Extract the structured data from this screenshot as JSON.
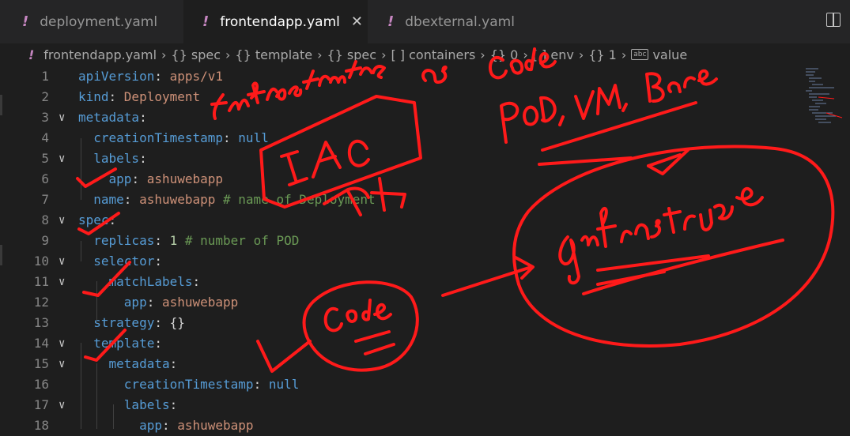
{
  "tabs": [
    {
      "label": "deployment.yaml",
      "active": false
    },
    {
      "label": "frontendapp.yaml",
      "active": true
    },
    {
      "label": "dbexternal.yaml",
      "active": false
    }
  ],
  "breadcrumb": {
    "file": "frontendapp.yaml",
    "items": [
      "{} spec",
      "{} template",
      "{} spec",
      "[ ] containers",
      "{} 0",
      "[ ] env",
      "{} 1",
      "value"
    ]
  },
  "lines": [
    {
      "num": "1",
      "fold": "",
      "key": "apiVersion",
      "sep": ": ",
      "val": "apps/v1",
      "valtype": "v",
      "comment": ""
    },
    {
      "num": "2",
      "fold": "",
      "key": "kind",
      "sep": ": ",
      "val": "Deployment",
      "valtype": "v",
      "comment": ""
    },
    {
      "num": "3",
      "fold": "∨",
      "key": "metadata",
      "sep": ":",
      "val": "",
      "valtype": "v",
      "comment": ""
    },
    {
      "num": "4",
      "fold": "",
      "key": "  creationTimestamp",
      "sep": ": ",
      "val": "null",
      "valtype": "k",
      "comment": ""
    },
    {
      "num": "5",
      "fold": "∨",
      "key": "  labels",
      "sep": ":",
      "val": "",
      "valtype": "v",
      "comment": ""
    },
    {
      "num": "6",
      "fold": "",
      "key": "    app",
      "sep": ": ",
      "val": "ashuwebapp",
      "valtype": "v",
      "comment": ""
    },
    {
      "num": "7",
      "fold": "",
      "key": "  name",
      "sep": ": ",
      "val": "ashuwebapp",
      "valtype": "v",
      "comment": " # name of Deployment"
    },
    {
      "num": "8",
      "fold": "∨",
      "key": "spec",
      "sep": ":",
      "val": "",
      "valtype": "v",
      "comment": ""
    },
    {
      "num": "9",
      "fold": "",
      "key": "  replicas",
      "sep": ": ",
      "val": "1",
      "valtype": "n",
      "comment": " # number of POD"
    },
    {
      "num": "10",
      "fold": "∨",
      "key": "  selector",
      "sep": ":",
      "val": "",
      "valtype": "v",
      "comment": ""
    },
    {
      "num": "11",
      "fold": "∨",
      "key": "    matchLabels",
      "sep": ":",
      "val": "",
      "valtype": "v",
      "comment": ""
    },
    {
      "num": "12",
      "fold": "",
      "key": "      app",
      "sep": ": ",
      "val": "ashuwebapp",
      "valtype": "v",
      "comment": ""
    },
    {
      "num": "13",
      "fold": "",
      "key": "  strategy",
      "sep": ": ",
      "val": "{}",
      "valtype": "p",
      "comment": ""
    },
    {
      "num": "14",
      "fold": "∨",
      "key": "  template",
      "sep": ":",
      "val": "",
      "valtype": "v",
      "comment": ""
    },
    {
      "num": "15",
      "fold": "∨",
      "key": "    metadata",
      "sep": ":",
      "val": "",
      "valtype": "v",
      "comment": ""
    },
    {
      "num": "16",
      "fold": "",
      "key": "      creationTimestamp",
      "sep": ": ",
      "val": "null",
      "valtype": "k",
      "comment": ""
    },
    {
      "num": "17",
      "fold": "∨",
      "key": "      labels",
      "sep": ":",
      "val": "",
      "valtype": "v",
      "comment": ""
    },
    {
      "num": "18",
      "fold": "",
      "key": "        app",
      "sep": ": ",
      "val": "ashuwebapp",
      "valtype": "v",
      "comment": ""
    }
  ],
  "annotations": {
    "ink_color": "#ff1a1a",
    "notes": [
      "Infrastructure",
      "as",
      "Code",
      "POD, VM, Bare",
      "IAC",
      "Code",
      "Infrastructure"
    ]
  }
}
